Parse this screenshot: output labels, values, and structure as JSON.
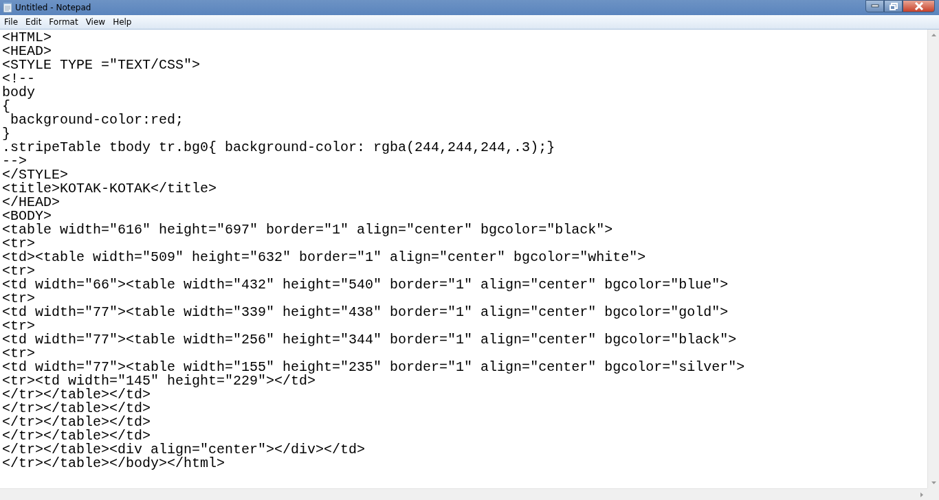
{
  "window": {
    "title": "Untitled - Notepad"
  },
  "menu": [
    "File",
    "Edit",
    "Format",
    "View",
    "Help"
  ],
  "editor": {
    "lines": [
      "<HTML>",
      "<HEAD>",
      "<STYLE TYPE =\"TEXT/CSS\">",
      "<!--",
      "body",
      "{",
      " background-color:red;",
      "}",
      ".stripeTable tbody tr.bg0{ background-color: rgba(244,244,244,.3);}",
      "-->",
      "</STYLE>",
      "<title>KOTAK-KOTAK</title>",
      "</HEAD>",
      "<BODY>",
      "<table width=\"616\" height=\"697\" border=\"1\" align=\"center\" bgcolor=\"black\">",
      "<tr>",
      "<td><table width=\"509\" height=\"632\" border=\"1\" align=\"center\" bgcolor=\"white\">",
      "<tr>",
      "<td width=\"66\"><table width=\"432\" height=\"540\" border=\"1\" align=\"center\" bgcolor=\"blue\">",
      "<tr>",
      "<td width=\"77\"><table width=\"339\" height=\"438\" border=\"1\" align=\"center\" bgcolor=\"gold\">",
      "<tr>",
      "<td width=\"77\"><table width=\"256\" height=\"344\" border=\"1\" align=\"center\" bgcolor=\"black\">",
      "<tr>",
      "<td width=\"77\"><table width=\"155\" height=\"235\" border=\"1\" align=\"center\" bgcolor=\"silver\">",
      "<tr><td width=\"145\" height=\"229\"></td>",
      "</tr></table></td>",
      "</tr></table></td>",
      "</tr></table></td>",
      "</tr></table></td>",
      "</tr></table><div align=\"center\"></div></td>",
      "</tr></table></body></html>"
    ]
  }
}
